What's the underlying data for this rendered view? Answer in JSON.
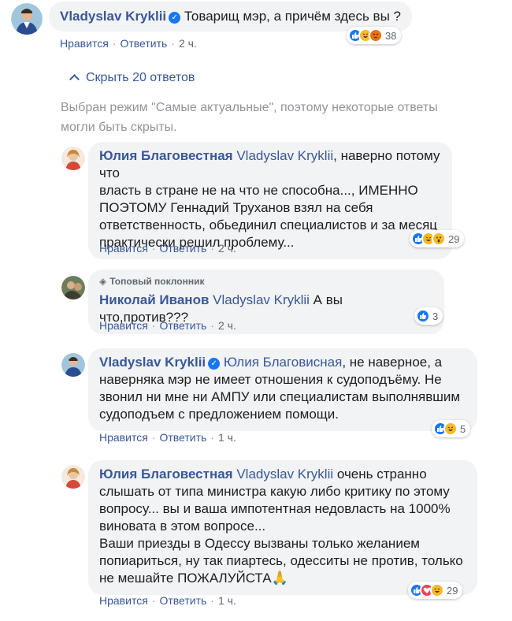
{
  "top_comment": {
    "author": "Vladyslav Kryklii",
    "text": "Товарищ мэр, а причём здесь вы ?",
    "actions": {
      "like": "Нравится",
      "reply": "Ответить",
      "time": "2 ч."
    },
    "reaction_count": "38",
    "reaction_icons": [
      "like-icon",
      "haha-icon",
      "angry-icon"
    ]
  },
  "replies_toggle": {
    "label": "Скрыть 20 ответов"
  },
  "mode_note": {
    "line1": "Выбран режим \"Самые актуальные\", поэтому некоторые ответы",
    "line2": "могли быть скрыты."
  },
  "replies": [
    {
      "author": "Юлия Благовестная",
      "mention": "Vladyslav Kryklii",
      "text_line1": ", наверно потому что",
      "lines": [
        "власть в стране не на что не способна..., ИМЕННО",
        "ПОЭТОМУ Геннадий Труханов взял на себя",
        "ответственность, обьединил специалистов и за месяц",
        "практически решил проблему..."
      ],
      "actions": {
        "like": "Нравится",
        "reply": "Ответить",
        "time": "2 ч."
      },
      "reaction_count": "29"
    },
    {
      "badge": "Топовый поклонник",
      "author": "Николай Иванов",
      "mention": "Vladyslav Kryklii",
      "text_line1": " А вы что,против???",
      "actions": {
        "like": "Нравится",
        "reply": "Ответить",
        "time": "2 ч."
      },
      "reaction_count": "3"
    },
    {
      "author": "Vladyslav Kryklii",
      "mention": "Юлия Благовисная",
      "text_line1": ", не наверное, а",
      "lines": [
        "наверняка мэр не имеет отношения к судоподъёму. Не",
        "звонил ни мне ни АМПУ или специалистам выполнявшим",
        "судоподъем с предложением помощи."
      ],
      "actions": {
        "like": "Нравится",
        "reply": "Ответить",
        "time": "1 ч."
      },
      "reaction_count": "5"
    },
    {
      "author": "Юлия Благовестная",
      "mention": "Vladyslav Kryklii",
      "text_line1": " очень странно",
      "lines": [
        "слышать от типа министра какую либо критику по этому",
        "вопросу... вы и ваша импотентная недовласть на 1000%",
        "виновата в этом вопросе...",
        "Ваши приезды в Одессу вызваны только желанием",
        "попиариться, ну так пиартесь, одесситы не против, только",
        "не мешайте ПОЖАЛУЙСТА🙏"
      ],
      "actions": {
        "like": "Нравится",
        "reply": "Ответить",
        "time": "1 ч."
      },
      "reaction_count": "29"
    }
  ],
  "colors": {
    "link": "#385898",
    "bubble": "#f2f3f5",
    "meta": "#606770",
    "muted": "#90949c",
    "like": "#1877f2",
    "haha": "#f7b928",
    "angry": "#e9710f",
    "love": "#f33e58"
  }
}
